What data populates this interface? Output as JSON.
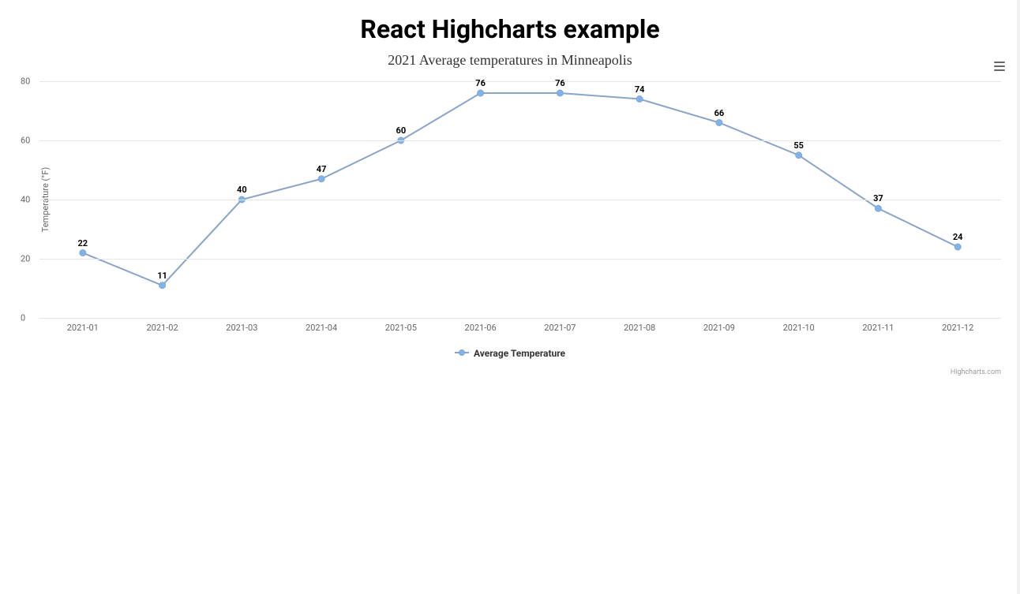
{
  "page_title": "React Highcharts example",
  "chart_title": "2021 Average temperatures in Minneapolis",
  "y_axis_label": "Temperature (°F)",
  "legend_label": "Average Temperature",
  "credits": "Highcharts.com",
  "y_ticks": [
    0,
    20,
    40,
    60,
    80
  ],
  "series_color": "#7cb5ec",
  "line_color": "#8aa4c8",
  "chart_data": {
    "type": "line",
    "title": "2021 Average temperatures in Minneapolis",
    "xlabel": "",
    "ylabel": "Temperature (°F)",
    "ylim": [
      0,
      80
    ],
    "categories": [
      "2021-01",
      "2021-02",
      "2021-03",
      "2021-04",
      "2021-05",
      "2021-06",
      "2021-07",
      "2021-08",
      "2021-09",
      "2021-10",
      "2021-11",
      "2021-12"
    ],
    "series": [
      {
        "name": "Average Temperature",
        "values": [
          22,
          11,
          40,
          47,
          60,
          76,
          76,
          74,
          66,
          55,
          37,
          24
        ]
      }
    ]
  }
}
